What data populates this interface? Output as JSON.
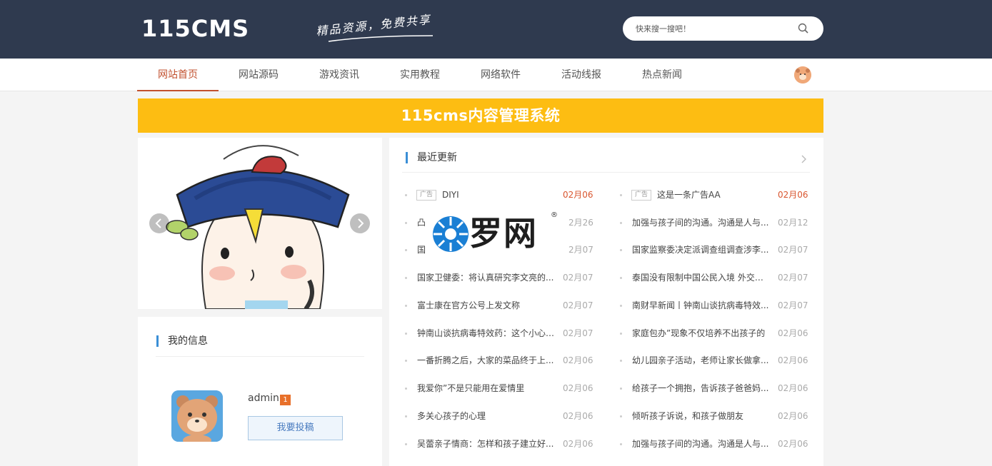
{
  "header": {
    "logo": "115CMS",
    "slogan": "精品资源，免费共享",
    "search_placeholder": "快来搜一搜吧！"
  },
  "nav": {
    "items": [
      {
        "label": "网站首页",
        "active": true
      },
      {
        "label": "网站源码"
      },
      {
        "label": "游戏资讯"
      },
      {
        "label": "实用教程"
      },
      {
        "label": "网络软件"
      },
      {
        "label": "活动线报"
      },
      {
        "label": "热点新闻"
      }
    ]
  },
  "banner": {
    "text": "115cms内容管理系统"
  },
  "user_panel": {
    "title": "我的信息",
    "username": "admin",
    "level": "1",
    "submit_label": "我要投稿"
  },
  "news": {
    "title": "最近更新",
    "watermark": {
      "text": "罗网",
      "reg": "®"
    },
    "left": [
      {
        "tag": "广告",
        "title": "DIYI",
        "date": "02月06",
        "hot": true
      },
      {
        "title": "凸",
        "date": "2月26"
      },
      {
        "title": "国",
        "date": "2月07"
      },
      {
        "title": "国家卫健委：将认真研究李文亮的...",
        "date": "02月07"
      },
      {
        "title": "富士康在官方公号上发文称",
        "date": "02月07"
      },
      {
        "title": "钟南山谈抗病毒特效药：这个小心 ...",
        "date": "02月07"
      },
      {
        "title": "一番折腾之后，大家的菜品终于上...",
        "date": "02月06"
      },
      {
        "title": "我爱你”不是只能用在爱情里",
        "date": "02月06"
      },
      {
        "title": "多关心孩子的心理",
        "date": "02月06"
      },
      {
        "title": "吴蕾亲子情商：怎样和孩子建立好...",
        "date": "02月06"
      }
    ],
    "right": [
      {
        "tag": "广告",
        "title": "这是一条广告AA",
        "date": "02月06",
        "hot": true
      },
      {
        "title": "加强与孩子间的沟通。沟通是人与...",
        "date": "02月12"
      },
      {
        "title": "国家监察委决定派调查组调查涉李...",
        "date": "02月07"
      },
      {
        "title": "泰国没有限制中国公民入境 外交部...",
        "date": "02月07"
      },
      {
        "title": "南财早新闻丨钟南山谈抗病毒特效...",
        "date": "02月07"
      },
      {
        "title": "家庭包办”现象不仅培养不出孩子的",
        "date": "02月06"
      },
      {
        "title": "幼儿园亲子活动，老师让家长做拿...",
        "date": "02月06"
      },
      {
        "title": "给孩子一个拥抱，告诉孩子爸爸妈...",
        "date": "02月06"
      },
      {
        "title": "倾听孩子诉说，和孩子做朋友",
        "date": "02月06"
      },
      {
        "title": "加强与孩子间的沟通。沟通是人与...",
        "date": "02月06"
      }
    ]
  },
  "colors": {
    "header_bg": "#2f3a4f",
    "banner_bg": "#fdbd12",
    "accent": "#c2512f",
    "hot_date": "#d9562f"
  }
}
